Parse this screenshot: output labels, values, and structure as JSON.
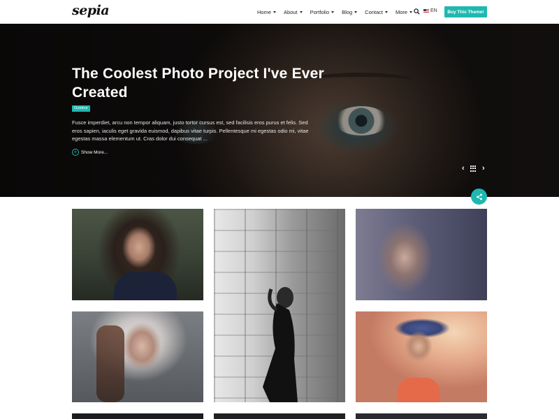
{
  "brand": {
    "logo_text": "sepia"
  },
  "nav": {
    "items": [
      {
        "label": "Home"
      },
      {
        "label": "About"
      },
      {
        "label": "Portfolio"
      },
      {
        "label": "Blog"
      },
      {
        "label": "Contact"
      },
      {
        "label": "More"
      }
    ],
    "lang_label": "EN",
    "buy_label": "Buy This Theme!"
  },
  "hero": {
    "title": "The Coolest Photo Project I've Ever Created",
    "tag": "Outdoor",
    "description": "Fusce imperdiet, arcu non tempor aliquam, justo tortor cursus est, sed facilisis eros purus et felis. Sed eros sapien, iaculis eget gravida euismod, dapibus vitae turpis. Pellentesque mi egestas odio mi, vitae egestas massa elementum ut. Cras dolor dui consequat ...",
    "show_more": "Show More...",
    "prev_glyph": "‹",
    "next_glyph": "›"
  },
  "colors": {
    "accent": "#1fb8b0"
  },
  "icons": {
    "search": "search-icon",
    "share": "share-icon",
    "grid": "grid-icon"
  }
}
